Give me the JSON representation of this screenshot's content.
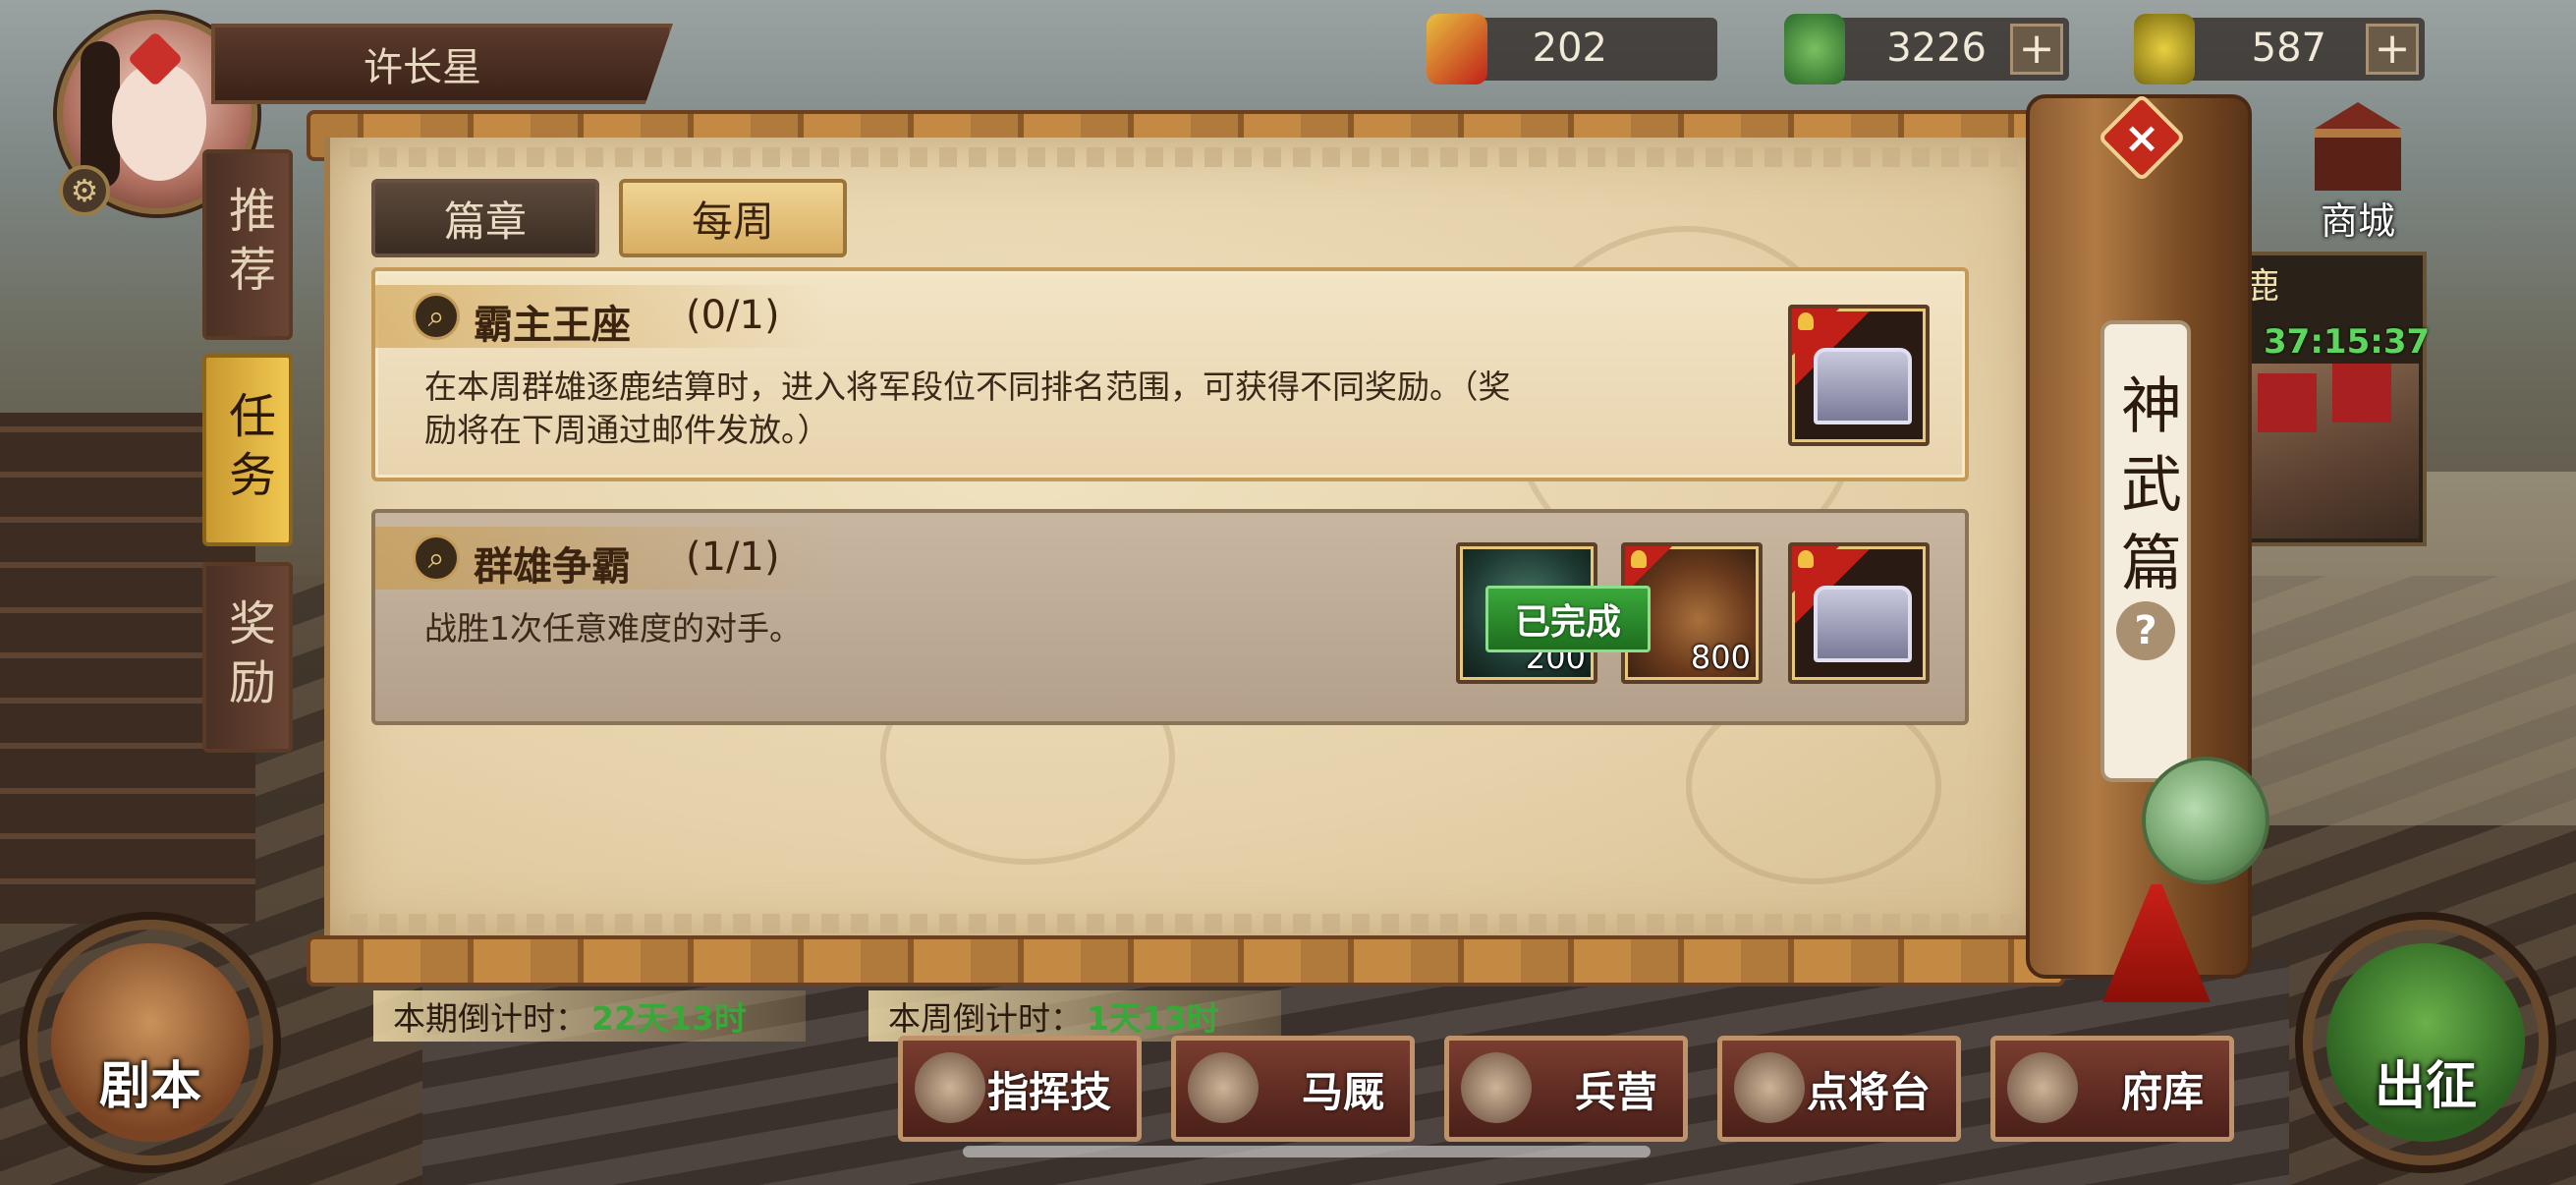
{
  "player": {
    "name": "许长星"
  },
  "resources": [
    {
      "icon": "red-token-icon",
      "value": "202"
    },
    {
      "icon": "jade-coin-icon",
      "value": "3226",
      "plus": "+"
    },
    {
      "icon": "gold-ingot-icon",
      "value": "587",
      "plus": "+"
    }
  ],
  "shop": {
    "label": "商城"
  },
  "event": {
    "title": "鹿",
    "timer": "37:15:37"
  },
  "side_tabs": [
    {
      "label": "推荐",
      "active": false
    },
    {
      "label": "任务",
      "active": true
    },
    {
      "label": "奖励",
      "active": false
    }
  ],
  "tabs": [
    {
      "label": "篇章",
      "active": false
    },
    {
      "label": "每周",
      "active": true
    }
  ],
  "quests": [
    {
      "name": "霸主王座",
      "progress": "(0/1)",
      "description": "在本周群雄逐鹿结算时，进入将军段位不同排名范围，可获得不同奖励。（奖励将在下周通过邮件发放。）",
      "rewards": [
        {
          "type": "chest-icon",
          "count": ""
        }
      ]
    },
    {
      "name": "群雄争霸",
      "progress": "(1/1)",
      "description": "战胜1次任意难度的对手。",
      "rewards": [
        {
          "type": "jade-coin-icon",
          "count": "200"
        },
        {
          "type": "copper-coin-icon",
          "count": "800"
        },
        {
          "type": "chest-icon",
          "count": ""
        }
      ],
      "completed_label": "已完成"
    }
  ],
  "side_panel": {
    "title": "神武篇",
    "help": "?"
  },
  "close": {
    "label": "×"
  },
  "countdowns": [
    {
      "label": "本期倒计时：",
      "value": "22天13时"
    },
    {
      "label": "本周倒计时：",
      "value": "1天13时"
    }
  ],
  "buttons": {
    "script": "剧本",
    "march": "出征"
  },
  "nav": [
    {
      "label": "指挥技",
      "icon": "command-icon"
    },
    {
      "label": "马厩",
      "icon": "horse-icon"
    },
    {
      "label": "兵营",
      "icon": "barracks-icon"
    },
    {
      "label": "点将台",
      "icon": "general-icon"
    },
    {
      "label": "府库",
      "icon": "treasury-icon"
    }
  ],
  "colors": {
    "accent_gold": "#f0c850",
    "timer_green": "#5cd65c",
    "done_green": "#3aa83a",
    "close_red": "#c42a1c"
  }
}
